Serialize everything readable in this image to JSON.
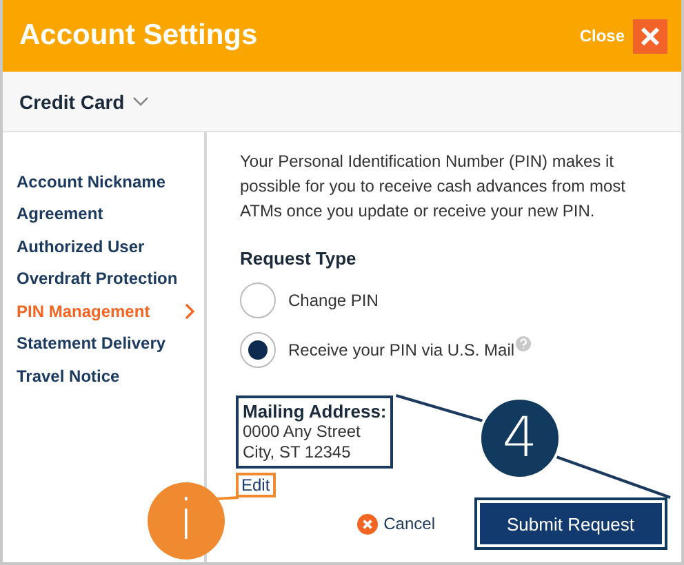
{
  "window": {
    "title": "Account Settings",
    "close_label": "Close"
  },
  "account_selector": {
    "value": "Credit Card"
  },
  "sidebar": {
    "items": [
      {
        "label": "Account Nickname",
        "selected": false
      },
      {
        "label": "Agreement",
        "selected": false
      },
      {
        "label": "Authorized User",
        "selected": false
      },
      {
        "label": "Overdraft Protection",
        "selected": false
      },
      {
        "label": "PIN Management",
        "selected": true
      },
      {
        "label": "Statement Delivery",
        "selected": false
      },
      {
        "label": "Travel Notice",
        "selected": false
      }
    ]
  },
  "content": {
    "description": "Your Personal Identification Number (PIN) makes it possible for you to receive cash advances from most ATMs once you update or receive your new PIN.",
    "request_type": {
      "heading": "Request Type",
      "options": [
        {
          "label": "Change PIN",
          "selected": false,
          "help": false
        },
        {
          "label": "Receive your PIN via U.S. Mail",
          "selected": true,
          "help": true
        }
      ]
    },
    "mailing_address": {
      "heading": "Mailing Address:",
      "lines": [
        "0000 Any Street",
        "City, ST 12345"
      ],
      "highlighted": true
    },
    "edit_link": {
      "label": "Edit",
      "highlighted": true
    },
    "actions": {
      "cancel": "Cancel",
      "submit": "Submit Request",
      "submit_highlighted": true
    }
  },
  "callouts": [
    {
      "label": "4",
      "color": "#123a5e"
    },
    {
      "label": "i",
      "color": "#f08a30"
    }
  ]
}
